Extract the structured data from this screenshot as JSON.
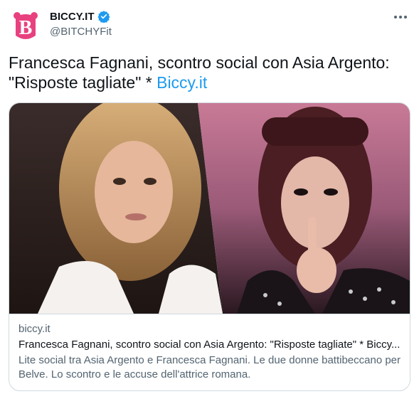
{
  "account": {
    "display_name": "BICCY.IT",
    "handle": "@BITCHYFit",
    "verified": true,
    "avatar_icon": "biccy-logo-icon",
    "brand_color": "#e8417f"
  },
  "tweet": {
    "text": "Francesca Fagnani, scontro social con Asia Argento: \"Risposte tagliate\" * ",
    "link_text": "Biccy.it",
    "link_color": "#1d9bf0"
  },
  "card": {
    "domain": "biccy.it",
    "title": "Francesca Fagnani, scontro social con Asia Argento: \"Risposte tagliate\" * Biccy...",
    "description": "Lite social tra Asia Argento e Francesca Fagnani. Le due donne battibeccano per Belve. Lo scontro e le accuse dell'attrice romana."
  },
  "icons": [
    "biccy-logo-icon",
    "verified-badge-icon",
    "more-options-icon"
  ]
}
